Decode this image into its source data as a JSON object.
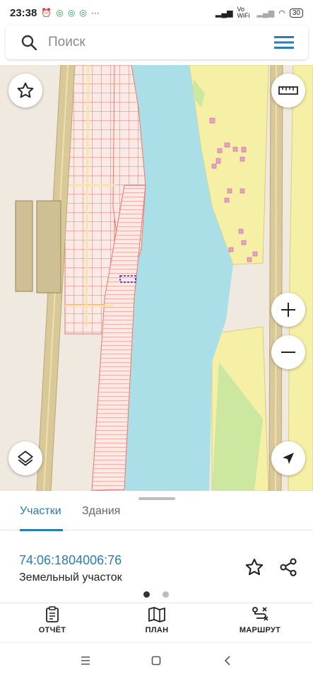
{
  "status_bar": {
    "time": "23:38",
    "network": "Vo WiFi",
    "battery": "30"
  },
  "search": {
    "placeholder": "Поиск"
  },
  "bottom_sheet": {
    "tabs": [
      {
        "label": "Участки",
        "active": true
      },
      {
        "label": "Здания",
        "active": false
      }
    ],
    "parcel": {
      "cadastral_number": "74:06:1804006:76",
      "type": "Земельный участок"
    },
    "pager": {
      "count": 2,
      "active_index": 0
    }
  },
  "actions": [
    {
      "label": "ОТЧЁТ",
      "icon": "report-icon"
    },
    {
      "label": "ПЛАН",
      "icon": "map-plan-icon"
    },
    {
      "label": "МАРШРУТ",
      "icon": "route-icon"
    }
  ],
  "colors": {
    "accent": "#2a7db0",
    "water": "#aadfe8",
    "parcel_stroke": "#e8786e",
    "residential": "#f5f0a5",
    "greenery": "#cce8a0",
    "building": "#e9a1c9"
  },
  "icons": [
    "search-icon",
    "menu-icon",
    "star-icon",
    "ruler-icon",
    "zoom-in-icon",
    "zoom-out-icon",
    "layers-icon",
    "navigation-arrow-icon",
    "share-icon"
  ]
}
